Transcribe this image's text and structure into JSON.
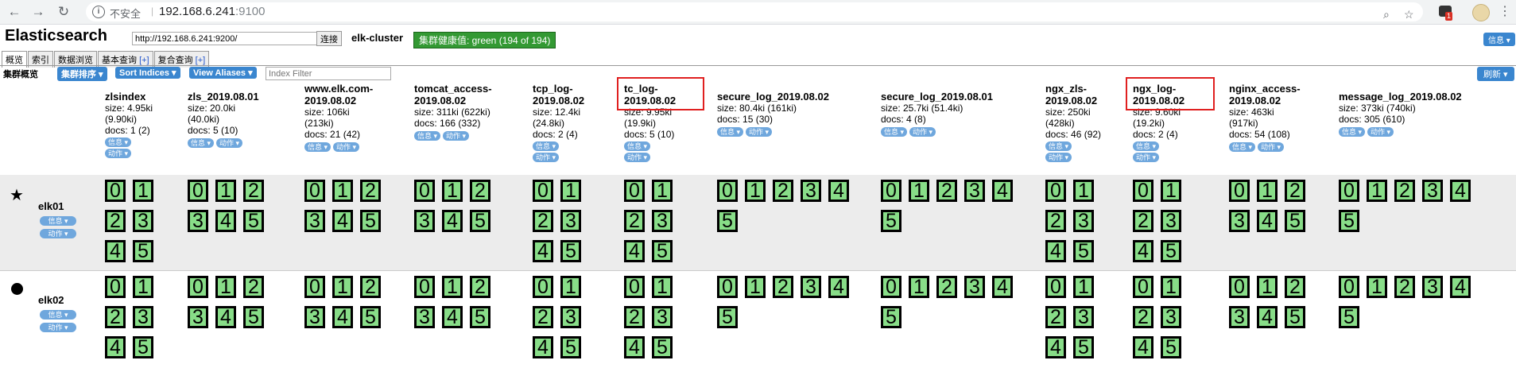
{
  "browser": {
    "insecure_label": "不安全",
    "url_host": "192.168.6.241",
    "url_port": ":9100",
    "ext_badge": "1"
  },
  "app": {
    "title": "Elasticsearch",
    "connect_url": "http://192.168.6.241:9200/",
    "connect_label": "连接",
    "cluster_name": "elk-cluster",
    "health": "集群健康值: green (194 of 194)",
    "info_label": "信息 ▾"
  },
  "tabs": [
    {
      "label": "概览"
    },
    {
      "label": "索引"
    },
    {
      "label": "数据浏览"
    },
    {
      "label": "基本查询",
      "plus": "[+]"
    },
    {
      "label": "复合查询",
      "plus": "[+]"
    }
  ],
  "toolbar": {
    "overview_label": "集群概览",
    "sort_cluster": "集群排序 ▾",
    "sort_indices": "Sort Indices ▾",
    "view_aliases": "View Aliases ▾",
    "index_filter_placeholder": "Index Filter",
    "refresh": "刷新 ▾"
  },
  "pill_labels": {
    "info": "信息 ▾",
    "action": "动作 ▾"
  },
  "indices": [
    {
      "name": "zlsindex",
      "size": "size: 4.95ki",
      "size2": "(9.90ki)",
      "docs": "docs: 1 (2)",
      "pills_stacked": true
    },
    {
      "name": "zls_2019.08.01",
      "size": "size: 20.0ki",
      "size2": "(40.0ki)",
      "docs": "docs: 5 (10)"
    },
    {
      "name": "www.elk.com-",
      "name2": "2019.08.02",
      "size": "size: 106ki",
      "size2": "(213ki)",
      "docs": "docs: 21 (42)"
    },
    {
      "name": "tomcat_access-",
      "name2": "2019.08.02",
      "size": "size: 311ki (622ki)",
      "docs": "docs: 166 (332)"
    },
    {
      "name": "tcp_log-",
      "name2": "2019.08.02",
      "size": "size: 12.4ki",
      "size2": "(24.8ki)",
      "docs": "docs: 2 (4)",
      "pills_stacked": true
    },
    {
      "name": "tc_log-",
      "name2": "2019.08.02",
      "size": "size: 9.95ki",
      "size2": "(19.9ki)",
      "docs": "docs: 5 (10)",
      "pills_stacked": true,
      "highlighted": true
    },
    {
      "name": "secure_log_2019.08.02",
      "size": "size: 80.4ki (161ki)",
      "docs": "docs: 15 (30)"
    },
    {
      "name": "secure_log_2019.08.01",
      "size": "size: 25.7ki (51.4ki)",
      "docs": "docs: 4 (8)"
    },
    {
      "name": "ngx_zls-",
      "name2": "2019.08.02",
      "size": "size: 250ki",
      "size2": "(428ki)",
      "docs": "docs: 46 (92)",
      "pills_stacked": true
    },
    {
      "name": "ngx_log-",
      "name2": "2019.08.02",
      "size": "size: 9.60ki",
      "size2": "(19.2ki)",
      "docs": "docs: 2 (4)",
      "pills_stacked": true,
      "highlighted": true
    },
    {
      "name": "nginx_access-",
      "name2": "2019.08.02",
      "size": "size: 463ki",
      "size2": "(917ki)",
      "docs": "docs: 54 (108)"
    },
    {
      "name": "message_log_2019.08.02",
      "size": "size: 373ki (740ki)",
      "docs": "docs: 305 (610)"
    }
  ],
  "nodes": [
    {
      "name": "elk01",
      "icon": "star-icon"
    },
    {
      "name": "elk02",
      "icon": "dot-icon"
    }
  ],
  "shard_groups": [
    {
      "shards": [
        "0",
        "1",
        "2",
        "3",
        "4",
        "5"
      ],
      "cols": 2
    },
    {
      "shards": [
        "0",
        "1",
        "2",
        "3",
        "4",
        "5"
      ],
      "cols": 3
    },
    {
      "shards": [
        "0",
        "1",
        "2",
        "3",
        "4",
        "5"
      ],
      "cols": 3
    },
    {
      "shards": [
        "0",
        "1",
        "2",
        "3",
        "4",
        "5"
      ],
      "cols": 3
    },
    {
      "shards": [
        "0",
        "1",
        "2",
        "3",
        "4",
        "5"
      ],
      "cols": 2
    },
    {
      "shards": [
        "0",
        "1",
        "2",
        "3",
        "4",
        "5"
      ],
      "cols": 2
    },
    {
      "shards": [
        "0",
        "1",
        "2",
        "3",
        "4",
        "5"
      ],
      "cols": 5
    },
    {
      "shards": [
        "0",
        "1",
        "2",
        "3",
        "4",
        "5"
      ],
      "cols": 5
    },
    {
      "shards": [
        "0",
        "1",
        "2",
        "3",
        "4",
        "5"
      ],
      "cols": 2
    },
    {
      "shards": [
        "0",
        "1",
        "2",
        "3",
        "4",
        "5"
      ],
      "cols": 2
    },
    {
      "shards": [
        "0",
        "1",
        "2",
        "3",
        "4",
        "5"
      ],
      "cols": 3
    },
    {
      "shards": [
        "0",
        "1",
        "2",
        "3",
        "4",
        "5"
      ],
      "cols": 5
    }
  ],
  "colors": {
    "shard_fill": "#88dd88",
    "health_green": "#339933",
    "pill_blue": "#3a86cf",
    "highlight_red": "#e02020"
  }
}
